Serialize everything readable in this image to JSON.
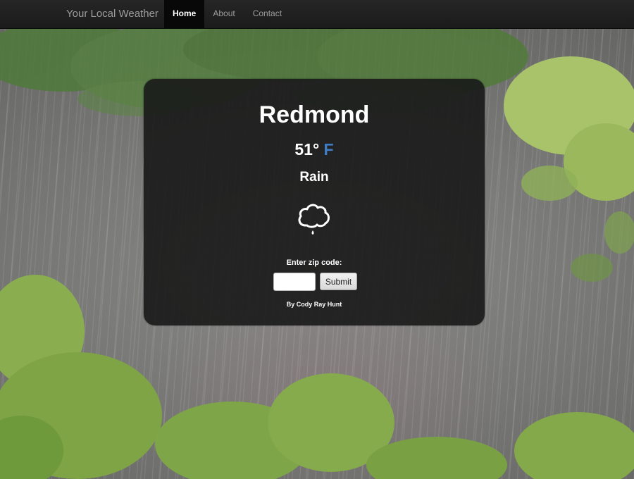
{
  "navbar": {
    "brand": "Your Local Weather",
    "items": [
      {
        "label": "Home",
        "active": true
      },
      {
        "label": "About",
        "active": false
      },
      {
        "label": "Contact",
        "active": false
      }
    ]
  },
  "weather": {
    "city": "Redmond",
    "temperature": "51°",
    "unit": "F",
    "condition": "Rain",
    "icon": "rain-cloud-icon"
  },
  "form": {
    "label": "Enter zip code:",
    "zip_value": "",
    "submit_label": "Submit"
  },
  "footer": {
    "credit": "By Cody Ray Hunt"
  },
  "colors": {
    "navbar": "#1b1b1b",
    "card": "#181818",
    "unit_accent": "#3f7ec6",
    "text": "#ffffff"
  },
  "background": {
    "scene": "rainy-forest-photo"
  }
}
